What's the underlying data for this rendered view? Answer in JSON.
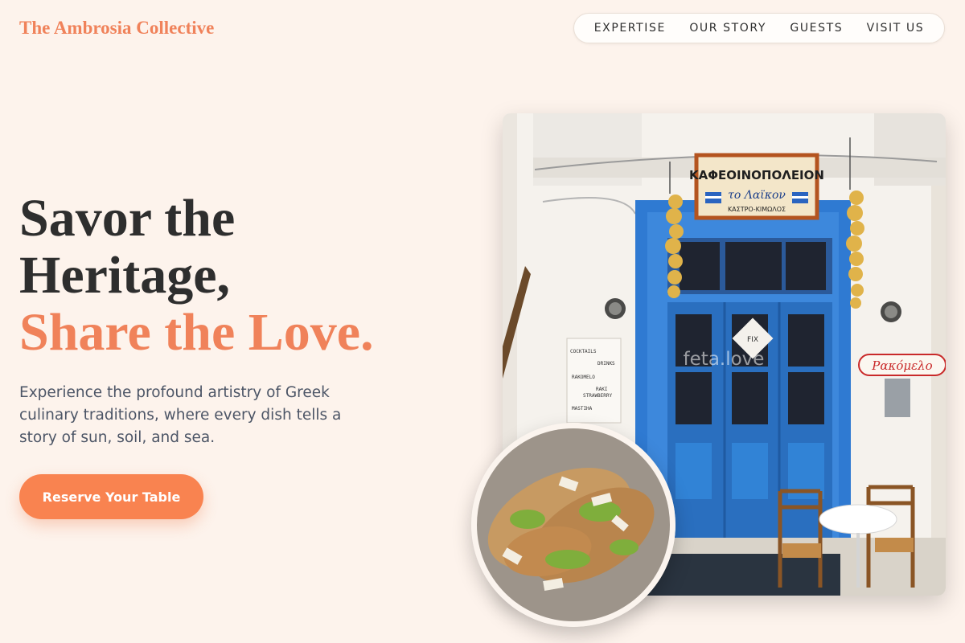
{
  "brand": {
    "name": "The Ambrosia Collective"
  },
  "nav": {
    "items": [
      "EXPERTISE",
      "OUR STORY",
      "GUESTS",
      "VISIT US"
    ]
  },
  "hero": {
    "title_line1": "Savor the",
    "title_line2": "Heritage,",
    "title_accent": "Share the Love.",
    "lede": "Experience the profound artistry of Greek culinary traditions, where every dish tells a story of sun, soil, and sea.",
    "cta_label": "Reserve Your Table"
  },
  "photo": {
    "sign_line1": "ΚΑΦΕΟΙΝΟΠΟΛΕΙΟΝ",
    "sign_line2": "το Λαϊκον",
    "sign_line3": "ΚΑΣΤΡΟ-ΚΙΜΩΛΟΣ",
    "menu_items": [
      "COCKTAILS",
      "DRINKS",
      "RAKOMELO",
      "RAKI",
      "STRAWBERRY",
      "MASTIHA"
    ],
    "watermark": "feta.love",
    "rakomelo_sign": "Ρακόμελο"
  },
  "colors": {
    "accent": "#f0825a",
    "cta": "#f98350",
    "background": "#fdf3ec",
    "door_blue": "#2f7ad2"
  }
}
